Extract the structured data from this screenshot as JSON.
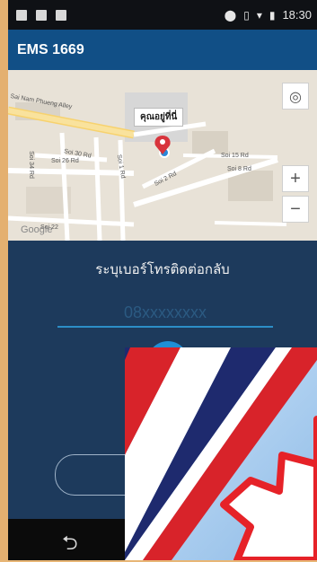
{
  "status_bar": {
    "time": "18:30",
    "left_icons": [
      "notification-icon",
      "image-icon",
      "notification-icon"
    ],
    "right_icons": [
      "location-icon",
      "vibrate-icon",
      "wifi-icon",
      "battery-icon"
    ]
  },
  "app_bar": {
    "title": "EMS 1669"
  },
  "map": {
    "location_callout": "คุณอยู่ที่นี่",
    "street_labels": [
      "Sai Nam Phueng Alley",
      "Soi 30 Rd",
      "Soi 26 Rd",
      "Soi 15 Rd",
      "Soi 8 Rd",
      "Soi 1 Rd",
      "Soi 2 Rd",
      "Soi 34 Rd",
      "Soi 22"
    ],
    "zoom_in": "+",
    "zoom_out": "−",
    "locate_icon": "my-location-icon",
    "google_logo": "Google"
  },
  "callback_panel": {
    "heading": "ระบุเบอร์โทรติดต่อกลับ",
    "phone_placeholder": "08xxxxxxxx"
  },
  "nav_bar": {
    "back_icon": "back-icon"
  },
  "overlay": {
    "icon": "ems-logo-icon"
  }
}
